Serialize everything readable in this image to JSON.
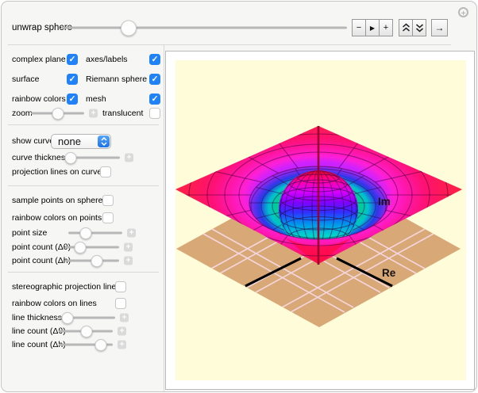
{
  "topbar": {
    "label": "unwrap sphere",
    "slider_pct": 23.5,
    "buttons": {
      "minus": "−",
      "play": "▶",
      "plus": "+",
      "arrow_right": "→"
    }
  },
  "ui": {
    "stepper_plus": "+",
    "options_plus": "+"
  },
  "palette": {
    "accent_blue": "#2082f6",
    "plot_background": "#fffcd9",
    "plane_tan": "#d9a877",
    "plane_grid_pink": "#f4d6de",
    "surface_red": "#ff2343",
    "surface_magenta": "#ff1fd6",
    "sphere_top_red": "#ff0026",
    "sphere_blue": "#3030ff",
    "moat_green": "#00d080",
    "center_line_maroon": "#99002e",
    "axis_black": "#000000"
  },
  "sidebar": {
    "toggle_grid": [
      {
        "label": "complex plane",
        "checked": true
      },
      {
        "label": "axes/labels",
        "checked": true
      },
      {
        "label": "surface",
        "checked": true
      },
      {
        "label": "Riemann sphere",
        "checked": true
      },
      {
        "label": "rainbow colors",
        "checked": true
      },
      {
        "label": "mesh",
        "checked": true
      }
    ],
    "zoom": {
      "label": "zoom",
      "pct": 50
    },
    "translucent": {
      "label": "translucent",
      "checked": false
    },
    "show_curve": {
      "label": "show curve",
      "value": "none"
    },
    "curve_thickness": {
      "label": "curve thickness",
      "pct": 13
    },
    "projection_lines_on_curve": {
      "label": "projection lines on curve",
      "checked": false
    },
    "sample_points": {
      "label": "sample points on sphere",
      "checked": false
    },
    "rainbow_points": {
      "label": "rainbow colors on points",
      "checked": false
    },
    "point_size": {
      "label": "point size",
      "pct": 32
    },
    "point_count_theta": {
      "label": "point count (Δθ)",
      "pct": 28
    },
    "point_count_h": {
      "label": "point count (Δh)",
      "pct": 59
    },
    "stereo_lines": {
      "label": "stereographic projection lines",
      "checked": false
    },
    "rainbow_lines": {
      "label": "rainbow colors on lines",
      "checked": false
    },
    "line_thickness": {
      "label": "line thickness",
      "pct": 15
    },
    "line_count_theta": {
      "label": "line count (Δθ)",
      "pct": 52
    },
    "line_count_h": {
      "label": "line count (Δh)",
      "pct": 78
    }
  },
  "plot": {
    "im_label": "Im",
    "re_label": "Re"
  }
}
